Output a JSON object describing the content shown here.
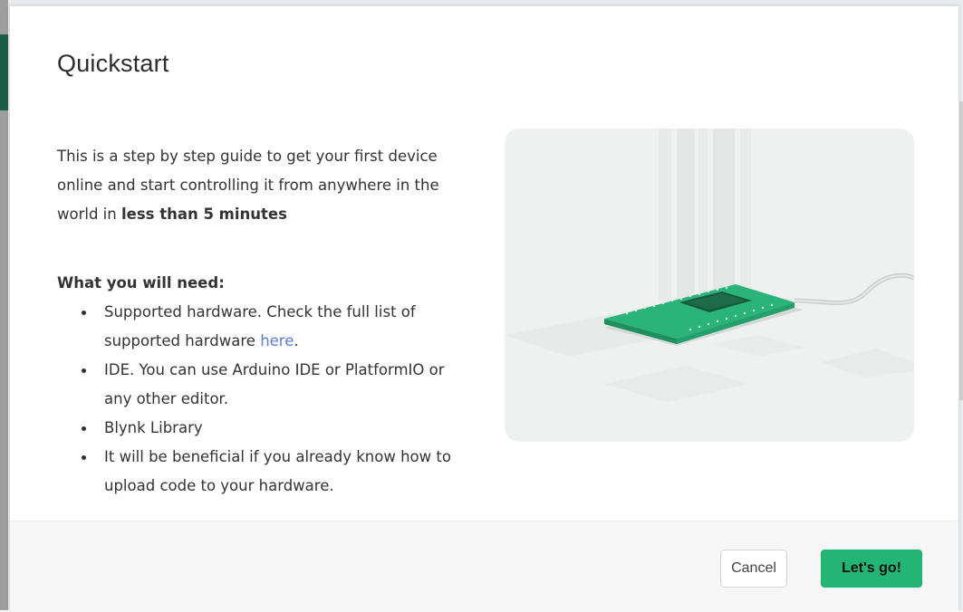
{
  "modal": {
    "title": "Quickstart",
    "intro_text": "This is a step by step guide to get your first device online and start controlling it from anywhere in the world in ",
    "intro_bold": "less than 5 minutes",
    "needs_title": "What you will need:",
    "needs": [
      {
        "text": "Supported hardware. Check the full list of supported hardware ",
        "link": "here",
        "suffix": "."
      },
      {
        "text": "IDE. You can use Arduino IDE or PlatformIO or any other editor."
      },
      {
        "text": "Blynk Library"
      },
      {
        "text": "It will be beneficial if you already know how to upload code to your hardware."
      }
    ],
    "illustration": {
      "icon": "circuit-board-illustration"
    }
  },
  "footer": {
    "cancel_label": "Cancel",
    "go_label": "Let's go!"
  },
  "colors": {
    "accent": "#22b573",
    "link": "#5b7bd6"
  }
}
